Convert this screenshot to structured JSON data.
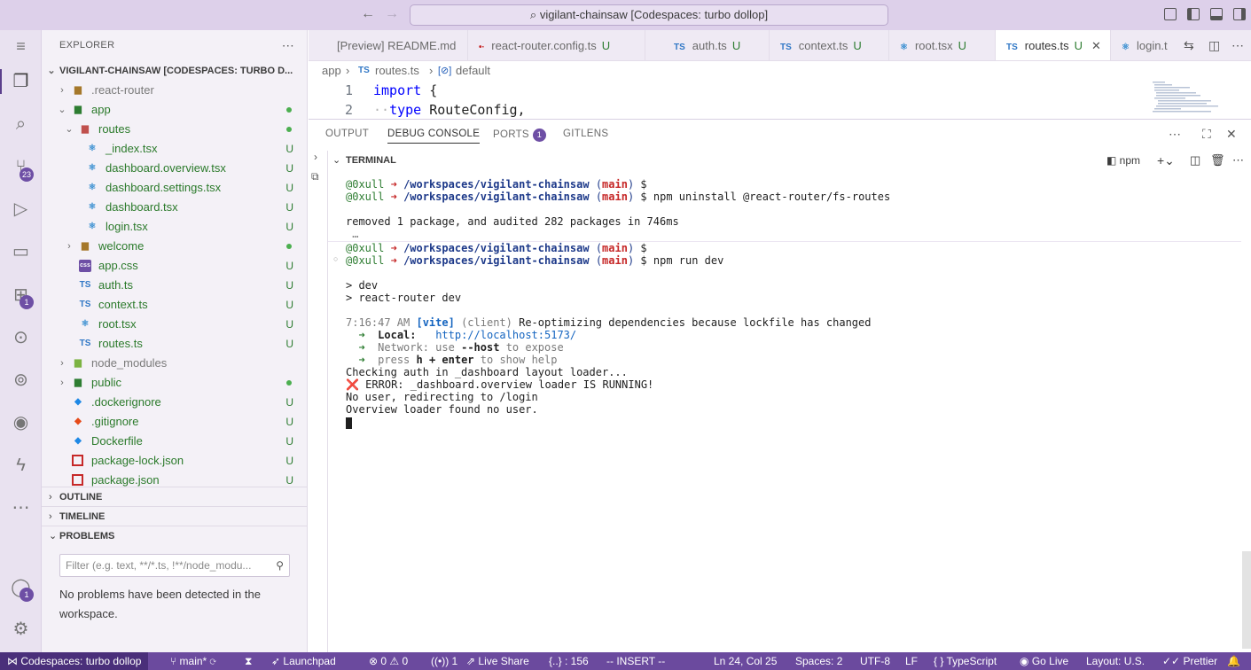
{
  "window": {
    "search_text": "vigilant-chainsaw [Codespaces: turbo dollop]"
  },
  "activity_badges": {
    "source_control": "23",
    "extensions": "1",
    "accounts": "1"
  },
  "explorer": {
    "header": "EXPLORER",
    "root": "VIGILANT-CHAINSAW [CODESPACES: TURBO D...",
    "items": [
      {
        "label": ".react-router",
        "status": ""
      },
      {
        "label": "app",
        "status": ""
      },
      {
        "label": "routes",
        "status": ""
      },
      {
        "label": "_index.tsx",
        "status": "U"
      },
      {
        "label": "dashboard.overview.tsx",
        "status": "U"
      },
      {
        "label": "dashboard.settings.tsx",
        "status": "U"
      },
      {
        "label": "dashboard.tsx",
        "status": "U"
      },
      {
        "label": "login.tsx",
        "status": "U"
      },
      {
        "label": "welcome",
        "status": ""
      },
      {
        "label": "app.css",
        "status": "U"
      },
      {
        "label": "auth.ts",
        "status": "U"
      },
      {
        "label": "context.ts",
        "status": "U"
      },
      {
        "label": "root.tsx",
        "status": "U"
      },
      {
        "label": "routes.ts",
        "status": "U"
      },
      {
        "label": "node_modules",
        "status": ""
      },
      {
        "label": "public",
        "status": ""
      },
      {
        "label": ".dockerignore",
        "status": "U"
      },
      {
        "label": ".gitignore",
        "status": "U"
      },
      {
        "label": "Dockerfile",
        "status": "U"
      },
      {
        "label": "package-lock.json",
        "status": "U"
      },
      {
        "label": "package.json",
        "status": "U"
      }
    ],
    "outline": "OUTLINE",
    "timeline": "TIMELINE",
    "problems": "PROBLEMS",
    "filter_placeholder": "Filter (e.g. text, **/*.ts, !**/node_modu...",
    "problems_message": "No problems have been detected in the workspace."
  },
  "tabs": [
    {
      "label": "[Preview] README.md",
      "status": ""
    },
    {
      "label": "react-router.config.ts",
      "status": "U"
    },
    {
      "label": "auth.ts",
      "status": "U"
    },
    {
      "label": "context.ts",
      "status": "U"
    },
    {
      "label": "root.tsx",
      "status": "U"
    },
    {
      "label": "routes.ts",
      "status": "U"
    },
    {
      "label": "login.t",
      "status": ""
    }
  ],
  "breadcrumb": {
    "folder": "app",
    "file": "routes.ts",
    "symbol": "default"
  },
  "editor": {
    "lines": [
      {
        "num": "1",
        "kw": "import",
        "rest": " {"
      },
      {
        "num": "2",
        "kw": "type",
        "rest": " RouteConfig,"
      }
    ]
  },
  "panel": {
    "tabs": [
      "OUTPUT",
      "DEBUG CONSOLE",
      "PORTS",
      "GITLENS"
    ],
    "ports_badge": "1",
    "terminal_label": "TERMINAL",
    "terminal_profile": "npm"
  },
  "terminal": {
    "user": "@0xull",
    "path": "/workspaces/vigilant-chainsaw",
    "branch": "main",
    "cmd1": "npm uninstall @react-router/fs-routes",
    "removed": "removed 1 package, and audited 282 packages in 746ms",
    "cmd2": "npm run dev",
    "dev1": "> dev",
    "dev2": "> react-router dev",
    "vite_time": "7:16:47 AM",
    "vite_tag": "[vite]",
    "vite_client": "(client)",
    "vite_msg": "Re-optimizing dependencies because lockfile has changed",
    "local_label": "Local:",
    "local_url": "http://localhost:5173/",
    "network_label": "Network:",
    "network_msg_a": "use",
    "network_msg_b": "--host",
    "network_msg_c": "to expose",
    "help_a": "press",
    "help_b": "h + enter",
    "help_c": "to show help",
    "log1": "Checking auth in _dashboard layout loader...",
    "log2": "❌ ERROR: _dashboard.overview loader IS RUNNING!",
    "log3": "No user, redirecting to /login",
    "log4": "Overview loader found no user."
  },
  "status": {
    "remote": "Codespaces: turbo dollop",
    "branch": "main*",
    "launchpad": "Launchpad",
    "errors": "0",
    "warnings": "0",
    "ports": "1",
    "liveshare": "Live Share",
    "braces": "{..} : 156",
    "mode": "-- INSERT --",
    "position": "Ln 24, Col 25",
    "spaces": "Spaces: 2",
    "encoding": "UTF-8",
    "eol": "LF",
    "language": "TypeScript",
    "golive": "Go Live",
    "layout": "Layout: U.S.",
    "prettier": "Prettier"
  }
}
